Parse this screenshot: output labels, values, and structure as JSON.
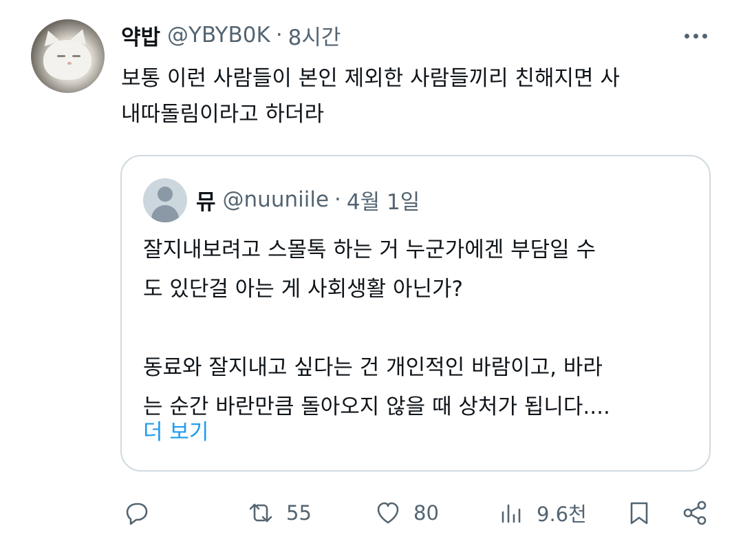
{
  "tweet": {
    "author_name": "약밥",
    "handle": "@YBYB0K",
    "separator": "·",
    "time": "8시간",
    "text": "보통 이런 사람들이 본인 제외한 사람들끼리 친해지면 사\n내따돌림이라고 하더라"
  },
  "quoted_tweet": {
    "author_name": "뮤",
    "handle": "@nuuniile",
    "separator": "·",
    "time": "4월 1일",
    "text": "잘지내보려고 스몰톡 하는 거 누군가에겐 부담일 수\n도 있단걸 아는 게 사회생활 아닌가?\n\n동료와 잘지내고 싶다는 건 개인적인 바람이고, 바라\n는 순간 바란만큼 돌아오지 않을 때 상처가 됩니다....",
    "show_more_label": "더 보기"
  },
  "actions": {
    "reply_count": "",
    "retweet_count": "55",
    "like_count": "80",
    "views_count": "9.6천"
  },
  "icons": {
    "more": "more-horizontal-icon",
    "reply": "reply-icon",
    "retweet": "retweet-icon",
    "like": "heart-icon",
    "views": "views-chart-icon",
    "bookmark": "bookmark-icon",
    "share": "share-icon"
  },
  "colors": {
    "link": "#1d9bf0",
    "secondary_text": "#536471",
    "border": "#cfd9de"
  }
}
